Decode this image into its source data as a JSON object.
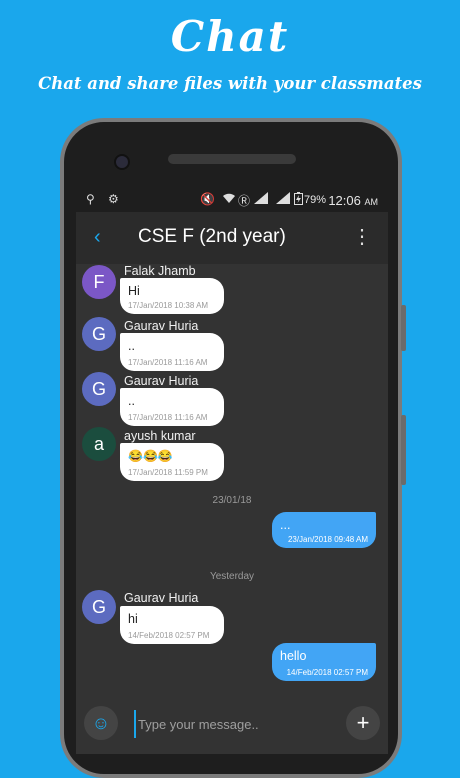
{
  "promo": {
    "title": "Chat",
    "subtitle": "Chat and share files with your classmates"
  },
  "status_bar": {
    "battery": "79%",
    "time": "12:06",
    "ampm": "AM"
  },
  "toolbar": {
    "title": "CSE F (2nd year)"
  },
  "messages": [
    {
      "avatar": "F",
      "sender": "Falak Jhamb",
      "text": "Hi",
      "time": "17/Jan/2018 10:38 AM",
      "avatar_color": "#7b57c6"
    },
    {
      "avatar": "G",
      "sender": "Gaurav Huria",
      "text": "..",
      "time": "17/Jan/2018 11:16 AM",
      "avatar_color": "#5c6bc0"
    },
    {
      "avatar": "G",
      "sender": "Gaurav Huria",
      "text": "..",
      "time": "17/Jan/2018 11:16 AM",
      "avatar_color": "#5c6bc0"
    },
    {
      "avatar": "a",
      "sender": "ayush kumar",
      "text": "😂😂😂",
      "time": "17/Jan/2018 11:59 PM",
      "avatar_color": "#1b4d3e"
    },
    {
      "date": "23/01/18"
    },
    {
      "outgoing": true,
      "text": "...",
      "time": "23/Jan/2018 09:48 AM"
    },
    {
      "date": "Yesterday"
    },
    {
      "avatar": "G",
      "sender": "Gaurav Huria",
      "text": "hi",
      "time": "14/Feb/2018 02:57 PM",
      "avatar_color": "#5c6bc0"
    },
    {
      "outgoing": true,
      "text": "hello",
      "time": "14/Feb/2018 02:57 PM"
    }
  ],
  "input": {
    "placeholder": "Type your message.."
  },
  "colors": {
    "background": "#1aa7ec",
    "outgoing_bubble": "#42a5f5",
    "accent": "#1aa7ec"
  }
}
